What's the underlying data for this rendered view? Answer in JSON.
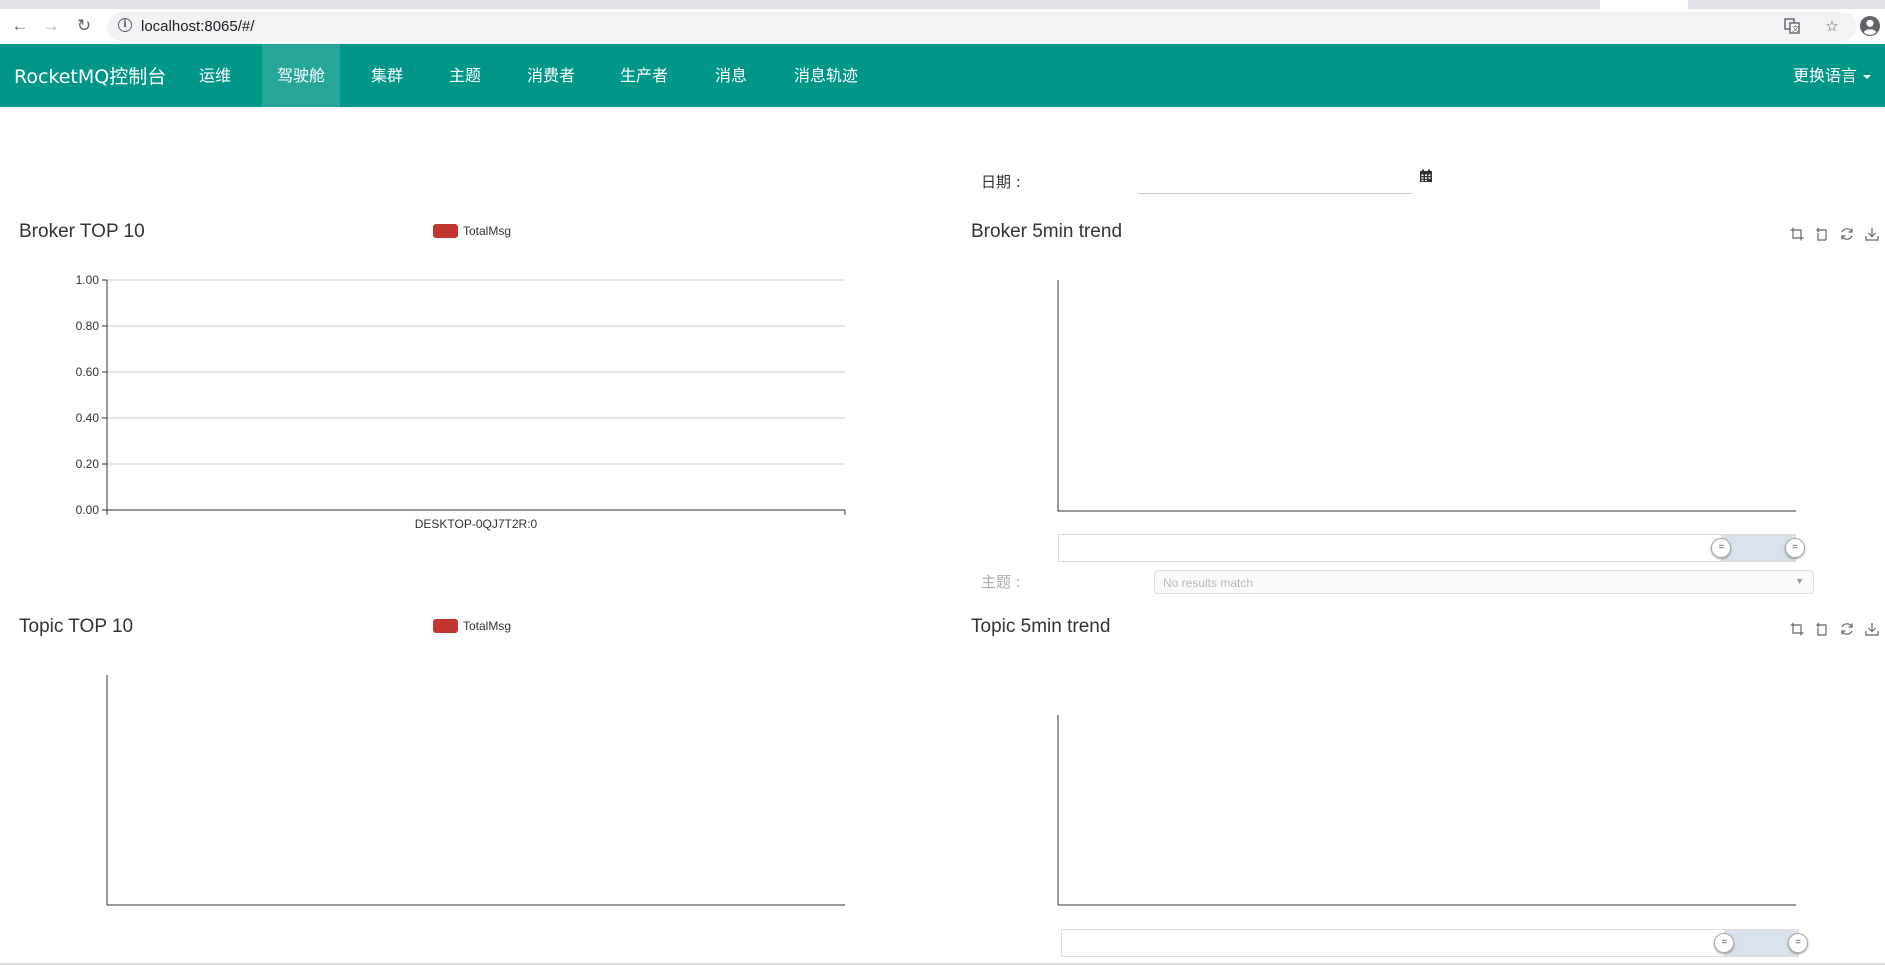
{
  "browser": {
    "url": "localhost:8065/#/",
    "icons": [
      "back-icon",
      "forward-icon",
      "reload-icon",
      "info-icon",
      "translate-icon",
      "star-icon",
      "profile-icon"
    ]
  },
  "navbar": {
    "brand": "RocketMQ控制台",
    "items": [
      {
        "label": "运维"
      },
      {
        "label": "驾驶舱",
        "active": true
      },
      {
        "label": "集群"
      },
      {
        "label": "主题"
      },
      {
        "label": "消费者"
      },
      {
        "label": "生产者"
      },
      {
        "label": "消息"
      },
      {
        "label": "消息轨迹"
      }
    ],
    "language": "更换语言",
    "color": "#009688"
  },
  "filters": {
    "date_label": "日期 :",
    "date_value": "",
    "topic_label": "主题 :",
    "topic_placeholder": "No results match"
  },
  "panels": {
    "broker_top": {
      "title": "Broker TOP 10",
      "legend": "TotalMsg"
    },
    "broker_trend": {
      "title": "Broker 5min trend"
    },
    "topic_top": {
      "title": "Topic TOP 10",
      "legend": "TotalMsg"
    },
    "topic_trend": {
      "title": "Topic 5min trend"
    }
  },
  "chart_data": [
    {
      "type": "bar",
      "title": "Broker TOP 10",
      "categories": [
        "DESKTOP-0QJ7T2R:0"
      ],
      "series": [
        {
          "name": "TotalMsg",
          "values": [
            0
          ]
        }
      ],
      "ylim": [
        0,
        1
      ],
      "yticks": [
        "1.00",
        "0.80",
        "0.60",
        "0.40",
        "0.20",
        "0.00"
      ],
      "grid": true,
      "legend": "top-center",
      "color": "#c23531"
    },
    {
      "type": "line",
      "title": "Broker 5min trend",
      "series": [],
      "data_zoom": [
        0.9,
        1.0
      ]
    },
    {
      "type": "bar",
      "title": "Topic TOP 10",
      "categories": [],
      "series": [
        {
          "name": "TotalMsg",
          "values": []
        }
      ],
      "legend": "top-center",
      "color": "#c23531"
    },
    {
      "type": "line",
      "title": "Topic 5min trend",
      "series": [],
      "data_zoom": [
        0.9,
        1.0
      ]
    }
  ]
}
